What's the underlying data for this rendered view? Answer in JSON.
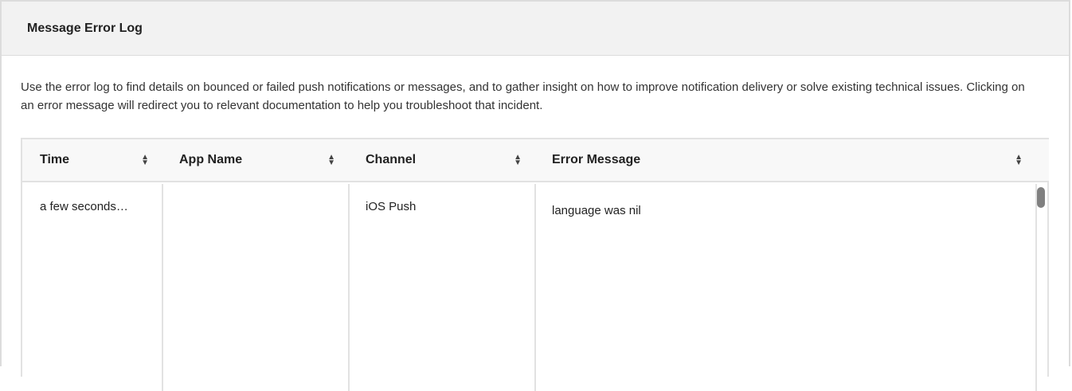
{
  "panel": {
    "title": "Message Error Log",
    "description": "Use the error log to find details on bounced or failed push notifications or messages, and to gather insight on how to improve notification delivery or solve existing technical issues. Clicking on an error message will redirect you to relevant documentation to help you troubleshoot that incident."
  },
  "table": {
    "columns": [
      "Time",
      "App Name",
      "Channel",
      "Error Message"
    ],
    "rows": [
      {
        "time": "a few seconds…",
        "app_name": "",
        "channel": "iOS Push",
        "error_message": "language was nil"
      }
    ]
  }
}
